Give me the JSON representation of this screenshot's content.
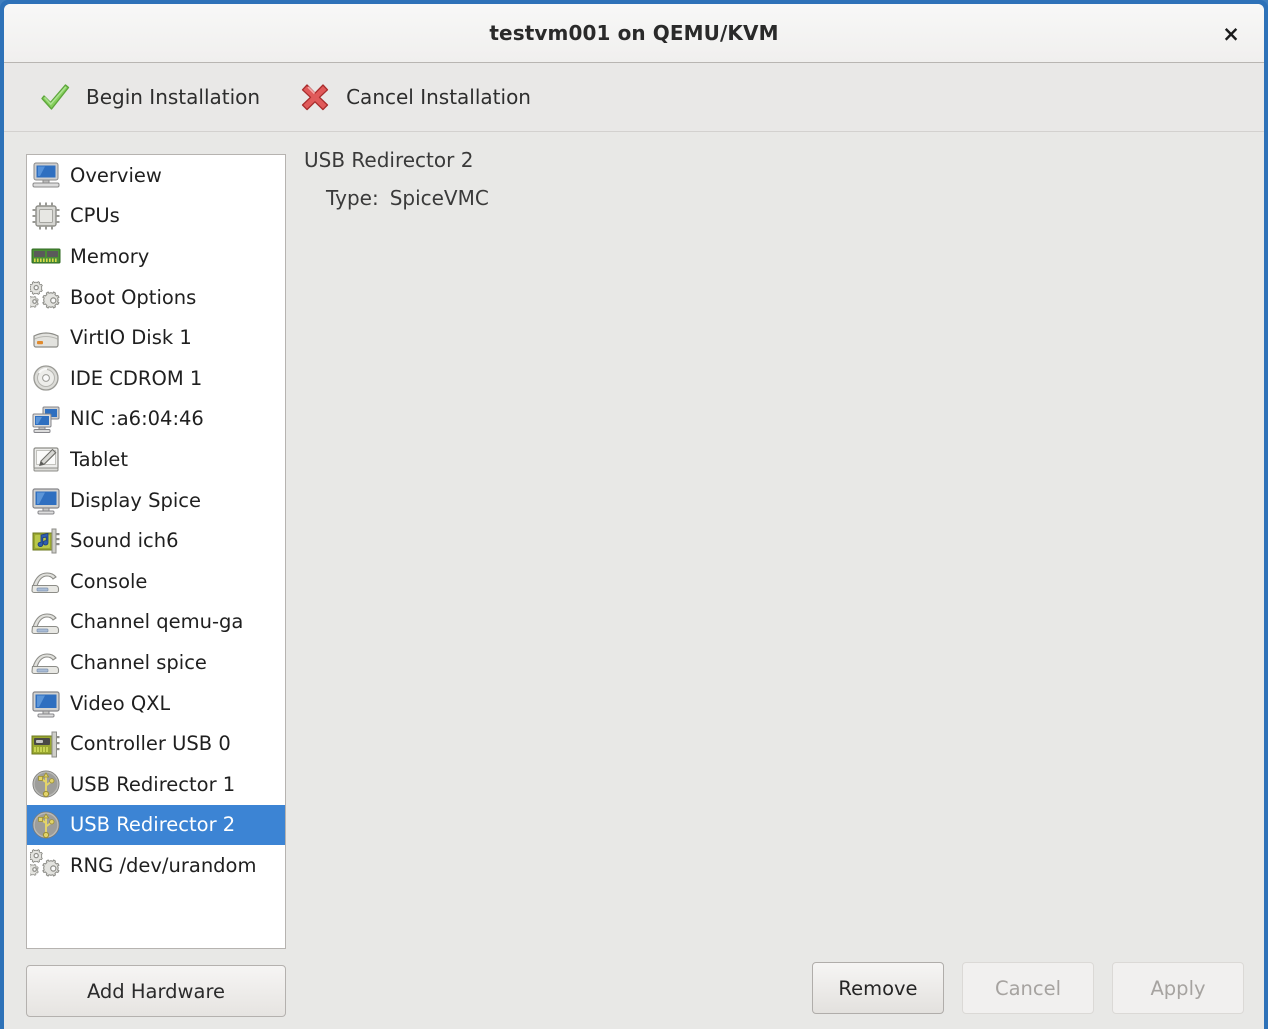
{
  "window": {
    "title": "testvm001 on QEMU/KVM",
    "close_label": "×",
    "frame_color": "#2e72b8"
  },
  "toolbar": {
    "buttons": [
      {
        "label": "Begin Installation",
        "icon": "green-check-icon",
        "color": "#73c252"
      },
      {
        "label": "Cancel Installation",
        "icon": "red-x-icon",
        "color": "#d94f4f"
      }
    ]
  },
  "sidebar": {
    "items": [
      {
        "label": "Overview",
        "icon": "computer-icon",
        "selected": false
      },
      {
        "label": "CPUs",
        "icon": "cpu-chip-icon",
        "selected": false
      },
      {
        "label": "Memory",
        "icon": "memory-ram-icon",
        "selected": false
      },
      {
        "label": "Boot Options",
        "icon": "gears-icon",
        "selected": false
      },
      {
        "label": "VirtIO Disk 1",
        "icon": "harddisk-icon",
        "selected": false
      },
      {
        "label": "IDE CDROM 1",
        "icon": "cdrom-disc-icon",
        "selected": false
      },
      {
        "label": "NIC :a6:04:46",
        "icon": "network-icon",
        "selected": false
      },
      {
        "label": "Tablet",
        "icon": "tablet-pen-icon",
        "selected": false
      },
      {
        "label": "Display Spice",
        "icon": "monitor-icon",
        "selected": false
      },
      {
        "label": "Sound ich6",
        "icon": "sound-card-icon",
        "selected": false
      },
      {
        "label": "Console",
        "icon": "console-icon",
        "selected": false
      },
      {
        "label": "Channel qemu-ga",
        "icon": "console-icon",
        "selected": false
      },
      {
        "label": "Channel spice",
        "icon": "console-icon",
        "selected": false
      },
      {
        "label": "Video QXL",
        "icon": "monitor-icon",
        "selected": false
      },
      {
        "label": "Controller USB 0",
        "icon": "controller-card-icon",
        "selected": false
      },
      {
        "label": "USB Redirector 1",
        "icon": "usb-icon",
        "selected": false
      },
      {
        "label": "USB Redirector 2",
        "icon": "usb-icon",
        "selected": true
      },
      {
        "label": "RNG /dev/urandom",
        "icon": "gears-icon",
        "selected": false
      }
    ],
    "selection_color": "#3c84d4",
    "add_hardware_label": "Add Hardware"
  },
  "detail": {
    "title": "USB Redirector 2",
    "fields": [
      {
        "key": "Type:",
        "value": "SpiceVMC"
      }
    ]
  },
  "actions": [
    {
      "label": "Remove",
      "enabled": true
    },
    {
      "label": "Cancel",
      "enabled": false
    },
    {
      "label": "Apply",
      "enabled": false
    }
  ]
}
